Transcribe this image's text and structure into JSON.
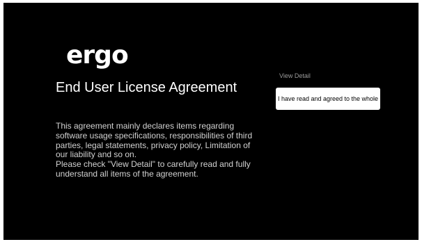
{
  "logo": {
    "text": "ergo"
  },
  "eula": {
    "title": "End User License Agreement",
    "paragraph1": "This agreement mainly declares items regarding software usage specifications, responsibilities of third parties, legal statements, privacy policy, Limitation of our liability and so on.",
    "paragraph2": "Please check \"View Detail\" to carefully read and fully understand all items of the agreement."
  },
  "actions": {
    "view_detail_label": "View Detail",
    "agree_label": "I have read and agreed to the whole"
  },
  "colors": {
    "background": "#000000",
    "text_primary": "#ffffff",
    "button_background": "#ffffff"
  }
}
